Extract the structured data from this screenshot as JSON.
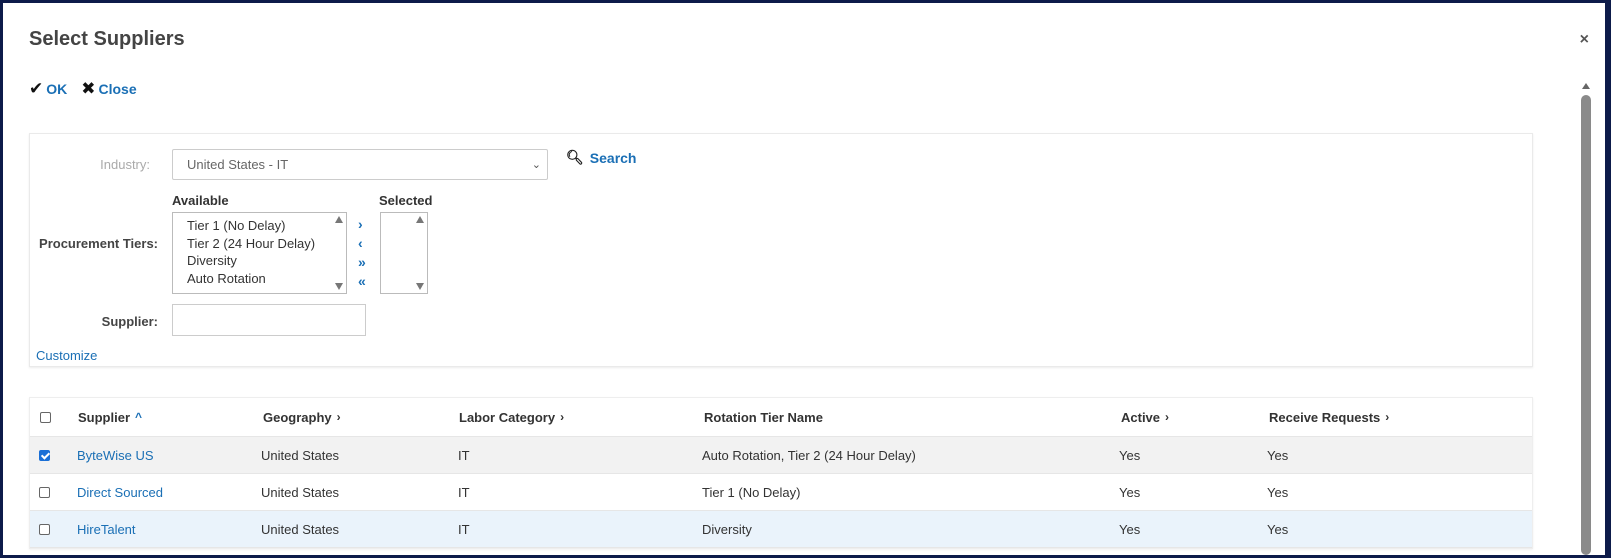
{
  "dialog": {
    "title": "Select Suppliers",
    "close_glyph": "×",
    "ok_label": "OK",
    "close_label": "Close"
  },
  "filters": {
    "industry_label": "Industry:",
    "industry_value": "United States - IT",
    "search_label": "Search",
    "tiers_label": "Procurement Tiers:",
    "available_header": "Available",
    "selected_header": "Selected",
    "available_options": [
      "Tier 1 (No Delay)",
      "Tier 2 (24 Hour Delay)",
      "Diversity",
      "Auto Rotation"
    ],
    "move_buttons": [
      "›",
      "‹",
      "»",
      "«"
    ],
    "supplier_label": "Supplier:",
    "supplier_value": "",
    "customize_label": "Customize"
  },
  "grid": {
    "columns": [
      "Supplier",
      "Geography",
      "Labor Category",
      "Rotation Tier Name",
      "Active",
      "Receive Requests"
    ],
    "sort_glyphs": {
      "asc": "^",
      "next": "›"
    },
    "rows": [
      {
        "checked": true,
        "supplier": "ByteWise US",
        "geography": "United States",
        "labor_category": "IT",
        "rotation_tier": "Auto Rotation, Tier 2 (24 Hour Delay)",
        "active": "Yes",
        "receive": "Yes"
      },
      {
        "checked": false,
        "supplier": "Direct Sourced",
        "geography": "United States",
        "labor_category": "IT",
        "rotation_tier": "Tier 1 (No Delay)",
        "active": "Yes",
        "receive": "Yes"
      },
      {
        "checked": false,
        "supplier": "HireTalent",
        "geography": "United States",
        "labor_category": "IT",
        "rotation_tier": "Diversity",
        "active": "Yes",
        "receive": "Yes"
      }
    ]
  },
  "colors": {
    "link": "#1a6fb5",
    "frame": "#0d1b4a",
    "checkbox_checked": "#1a6fd6"
  }
}
